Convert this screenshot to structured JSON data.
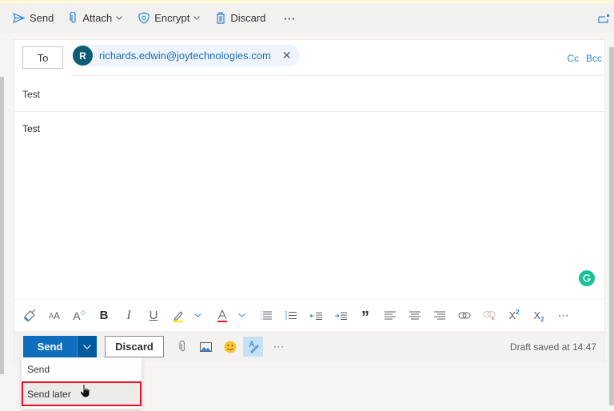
{
  "command_bar": {
    "send": "Send",
    "attach": "Attach",
    "encrypt": "Encrypt",
    "discard": "Discard",
    "more": "⋯"
  },
  "compose": {
    "to_label": "To",
    "recipient": {
      "initial": "R",
      "email": "richards.edwin@joytechnologies.com",
      "avatar_color": "#0f5c77"
    },
    "cc_label": "Cc",
    "bcc_label": "Bcc",
    "subject": "Test",
    "body": "Test"
  },
  "format_toolbar": {
    "items": [
      "format-painter",
      "font-size",
      "grow-font",
      "bold",
      "italic",
      "underline",
      "highlight",
      "highlight-dropdown",
      "font-color",
      "font-color-dropdown",
      "bullets",
      "numbering",
      "decrease-indent",
      "increase-indent",
      "quote",
      "align-left",
      "align-center",
      "align-right",
      "insert-link",
      "remove-link",
      "superscript",
      "subscript",
      "more"
    ],
    "bold_glyph": "B",
    "italic_glyph": "I",
    "underline_glyph": "U",
    "quote_glyph": "”",
    "more_glyph": "⋯"
  },
  "footer": {
    "send": "Send",
    "discard": "Discard",
    "more": "⋯",
    "draft_status": "Draft saved at 14:47"
  },
  "send_dropdown": {
    "items": [
      {
        "label": "Send",
        "highlighted": false
      },
      {
        "label": "Send later",
        "highlighted": true
      }
    ]
  },
  "colors": {
    "accent": "#106ebe",
    "accent_dark": "#005a9e",
    "link": "#2b88d8",
    "grammarly": "#15c39a",
    "highlight_box": "#e81123"
  }
}
